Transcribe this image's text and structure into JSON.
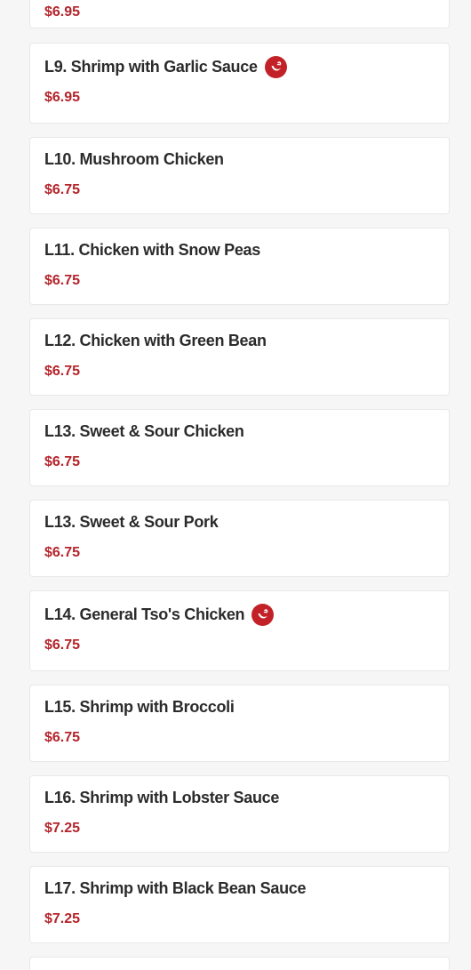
{
  "colors": {
    "price": "#b5242b",
    "name": "#2b2b2b",
    "spicy_badge": "#c22227",
    "card_bg": "#ffffff",
    "page_bg": "#f6f6f6"
  },
  "items": [
    {
      "name": "",
      "price": "$6.95",
      "spicy": false
    },
    {
      "name": "L9. Shrimp with Garlic Sauce",
      "price": "$6.95",
      "spicy": true,
      "icon": "chili-pepper-icon"
    },
    {
      "name": "L10. Mushroom Chicken",
      "price": "$6.75",
      "spicy": false
    },
    {
      "name": "L11. Chicken with Snow Peas",
      "price": "$6.75",
      "spicy": false
    },
    {
      "name": "L12. Chicken with Green Bean",
      "price": "$6.75",
      "spicy": false
    },
    {
      "name": "L13. Sweet & Sour Chicken",
      "price": "$6.75",
      "spicy": false
    },
    {
      "name": "L13. Sweet & Sour Pork",
      "price": "$6.75",
      "spicy": false
    },
    {
      "name": "L14. General Tso's Chicken",
      "price": "$6.75",
      "spicy": true,
      "icon": "chili-pepper-icon"
    },
    {
      "name": "L15. Shrimp with Broccoli",
      "price": "$6.75",
      "spicy": false
    },
    {
      "name": "L16. Shrimp with Lobster Sauce",
      "price": "$7.25",
      "spicy": false
    },
    {
      "name": "L17. Shrimp with Black Bean Sauce",
      "price": "$7.25",
      "spicy": false
    }
  ]
}
